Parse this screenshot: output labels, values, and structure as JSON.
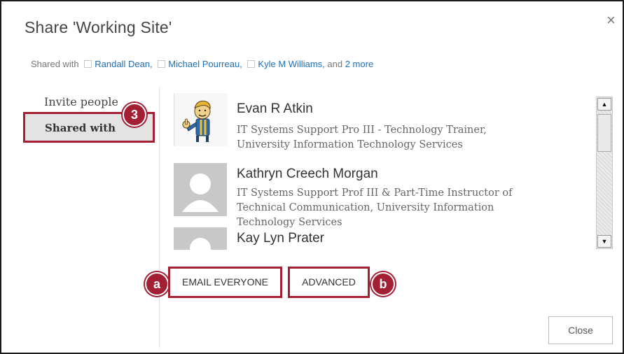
{
  "dialog": {
    "title": "Share 'Working Site'",
    "close_glyph": "×"
  },
  "shared_with_line": {
    "prefix": "Shared with",
    "people": [
      "Randall Dean,",
      "Michael Pourreau,",
      "Kyle M Williams,"
    ],
    "and_text": "and",
    "more_link": "2 more"
  },
  "nav": {
    "invite": "Invite people",
    "shared": "Shared with"
  },
  "callouts": {
    "step": "3",
    "a": "a",
    "b": "b"
  },
  "people": [
    {
      "name": "Evan R Atkin",
      "desc": "IT Systems Support Pro III - Technology Trainer, University Information Technology Services",
      "avatar_icon": "vault-boy-avatar-icon"
    },
    {
      "name": "Kathryn Creech Morgan",
      "desc": "IT Systems Support Prof III & Part-Time Instructor of Technical Communication, University Information Technology Services",
      "avatar_icon": "default-person-avatar-icon"
    },
    {
      "name": "Kay Lyn Prater",
      "desc": "",
      "avatar_icon": "default-person-avatar-icon"
    }
  ],
  "scrollbar": {
    "up_glyph": "▲",
    "down_glyph": "▼"
  },
  "actions": {
    "email_everyone": "EMAIL EVERYONE",
    "advanced": "ADVANCED",
    "close": "Close"
  },
  "colors": {
    "highlight": "#a31f34",
    "link": "#1f6fb5",
    "nav_selected_bg": "#e3e3e3"
  }
}
